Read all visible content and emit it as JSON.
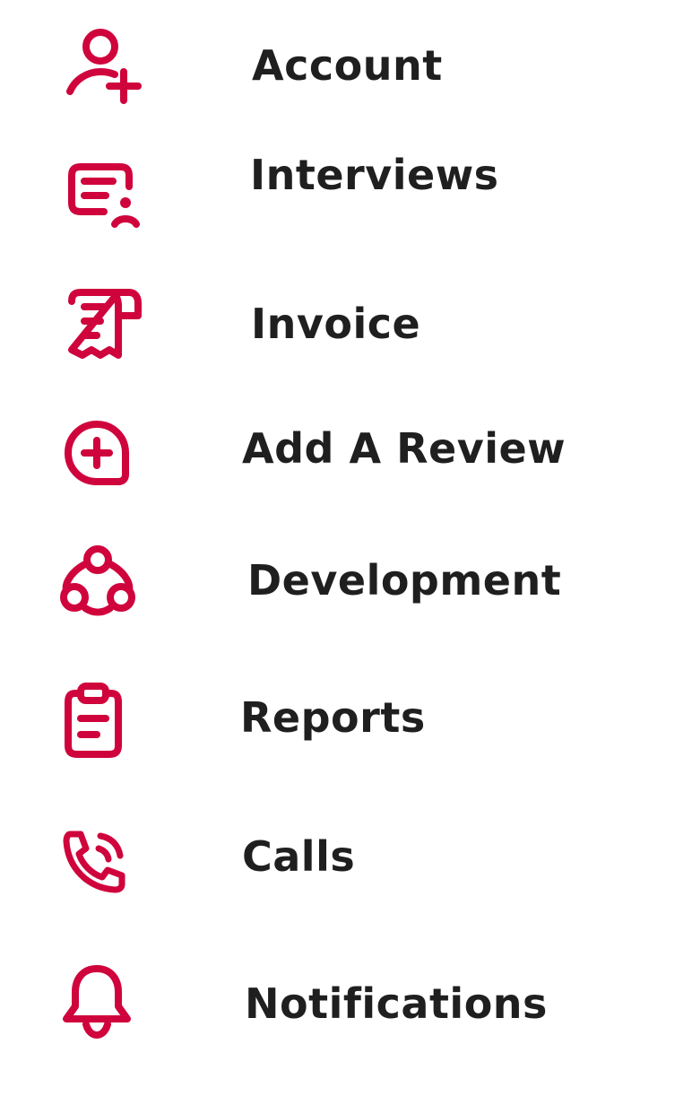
{
  "theme": {
    "icon_color": "#d0043c",
    "text_color": "#1f1f1f"
  },
  "menu": {
    "items": [
      {
        "label": "Account",
        "icon": "user-plus-icon"
      },
      {
        "label": "Interviews",
        "icon": "document-user-icon"
      },
      {
        "label": "Invoice",
        "icon": "receipt-icon"
      },
      {
        "label": "Add A Review",
        "icon": "plus-circle-bubble-icon"
      },
      {
        "label": "Development",
        "icon": "connected-nodes-icon"
      },
      {
        "label": "Reports",
        "icon": "clipboard-icon"
      },
      {
        "label": "Calls",
        "icon": "phone-call-icon"
      },
      {
        "label": "Notifications",
        "icon": "bell-icon"
      }
    ]
  }
}
